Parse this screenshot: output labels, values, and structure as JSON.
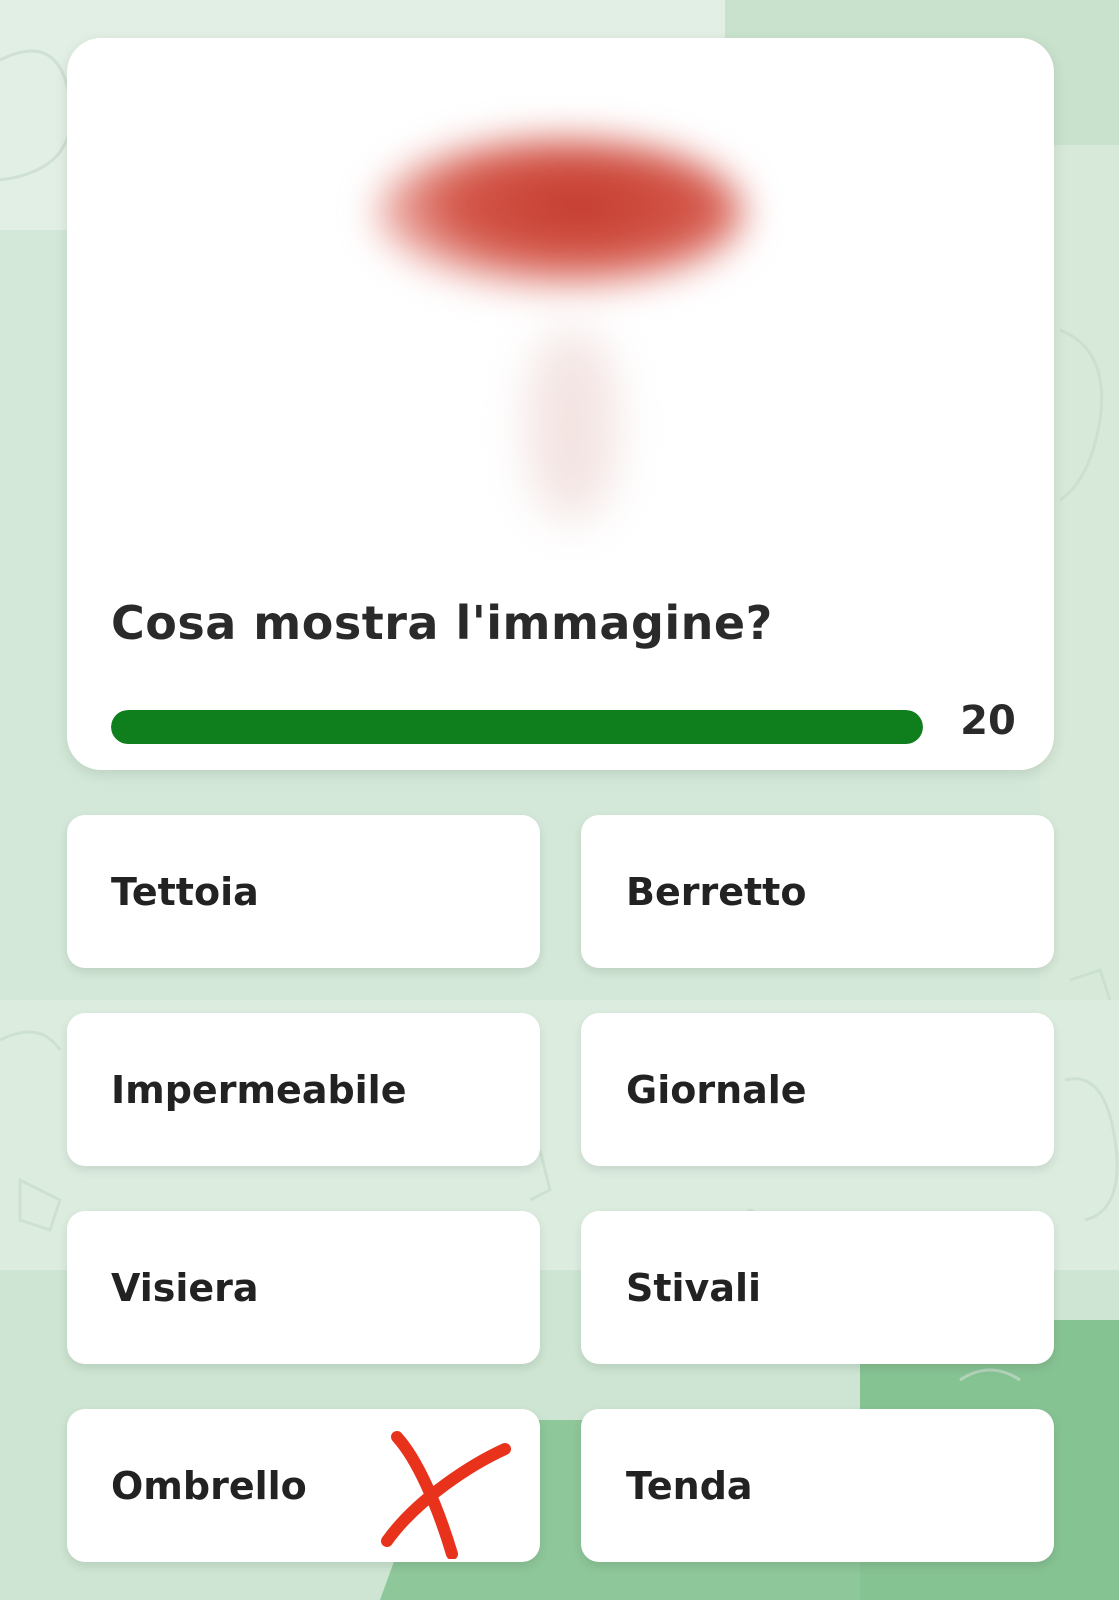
{
  "quiz": {
    "question": "Cosa mostra l'immagine?",
    "picture_icon": "blurred-mushroom-icon",
    "timer": {
      "value": "20",
      "progress_fraction": 1.0,
      "color": "#0f7f1e"
    },
    "answers": [
      {
        "label": "Tettoia"
      },
      {
        "label": "Berretto"
      },
      {
        "label": "Impermeabile"
      },
      {
        "label": "Giornale"
      },
      {
        "label": "Visiera"
      },
      {
        "label": "Stivali"
      },
      {
        "label": "Ombrello",
        "mark": "red-x-icon"
      },
      {
        "label": "Tenda"
      }
    ],
    "mark_color": "#e8321c"
  }
}
